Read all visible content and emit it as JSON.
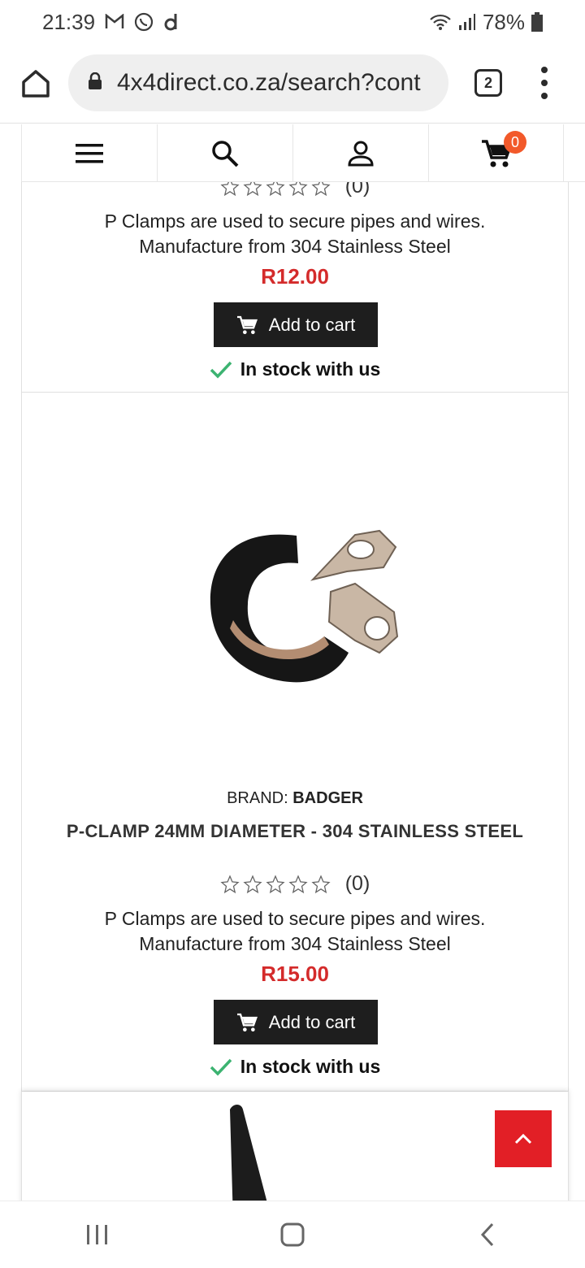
{
  "status_bar": {
    "time": "21:39",
    "battery": "78%",
    "left_icons": [
      "gmail-icon",
      "whatsapp-icon",
      "d-app-icon"
    ],
    "right_icons": [
      "wifi-icon",
      "signal-icon",
      "battery-icon"
    ]
  },
  "browser": {
    "url": "4x4direct.co.za/search?cont",
    "tab_count": "2"
  },
  "site_nav": {
    "items": [
      "menu-icon",
      "search-icon",
      "account-icon",
      "cart-icon"
    ],
    "cart_count": "0"
  },
  "products": [
    {
      "reviews": "(0)",
      "description_line1": "P Clamps are used to secure pipes and wires.",
      "description_line2": "Manufacture from 304 Stainless Steel",
      "price": "R12.00",
      "cart_label": "Add to cart",
      "stock": "In stock with us"
    },
    {
      "brand_label": "BRAND:",
      "brand_name": "BADGER",
      "title": "P-CLAMP 24MM DIAMETER - 304 STAINLESS STEEL",
      "reviews": "(0)",
      "description_line1": "P Clamps are used to secure pipes and wires.",
      "description_line2": "Manufacture from 304 Stainless Steel",
      "price": "R15.00",
      "cart_label": "Add to cart",
      "stock": "In stock with us"
    }
  ],
  "colors": {
    "price": "#d42b2b",
    "cart_button": "#1e1e1e",
    "badge": "#f2592a",
    "scroll_top": "#e21f26",
    "stock_check": "#3cb371"
  }
}
